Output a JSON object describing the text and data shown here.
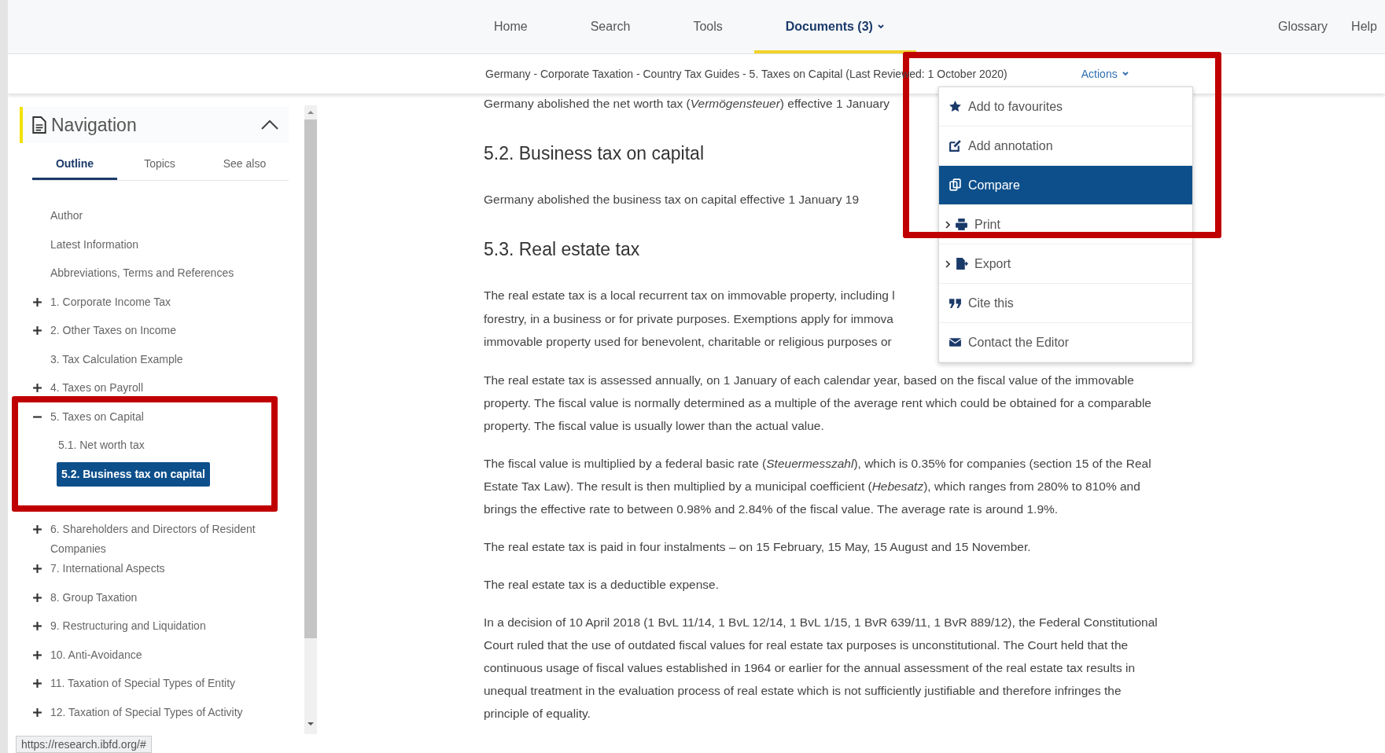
{
  "top_nav": {
    "items": [
      {
        "label": "Home",
        "selected": false,
        "caret": false
      },
      {
        "label": "Search",
        "selected": false,
        "caret": false
      },
      {
        "label": "Tools",
        "selected": false,
        "caret": false
      },
      {
        "label": "Documents (3)",
        "selected": true,
        "caret": true
      }
    ],
    "right_links": [
      "Glossary",
      "Help"
    ]
  },
  "breadcrumb": {
    "text": "Germany - Corporate Taxation - Country Tax Guides - 5. Taxes on Capital (Last Reviewed: 1 October 2020)",
    "actions": "Actions"
  },
  "sidebar": {
    "title": "Navigation",
    "expanded": true,
    "tabs": [
      {
        "label": "Outline",
        "selected": true
      },
      {
        "label": "Topics",
        "selected": false
      },
      {
        "label": "See also",
        "selected": false
      }
    ],
    "items": [
      {
        "label": "Author",
        "selected": false
      },
      {
        "label": "Latest Information",
        "selected": false
      },
      {
        "label": "Abbreviations, Terms and References",
        "selected": false
      },
      {
        "label": "1. Corporate Income Tax",
        "selected": false,
        "expanded": false
      },
      {
        "label": "2. Other Taxes on Income",
        "selected": false,
        "expanded": false
      },
      {
        "label": "3. Tax Calculation Example",
        "selected": false
      },
      {
        "label": "4. Taxes on Payroll",
        "selected": false,
        "expanded": false
      },
      {
        "label": "5. Taxes on Capital",
        "selected": false,
        "expanded": true,
        "children": [
          {
            "label": "5.1. Net worth tax",
            "selected": false
          },
          {
            "label": "5.2. Business tax on capital",
            "selected": true
          }
        ]
      },
      {
        "label": "6. Shareholders and Directors of Resident Companies",
        "selected": false,
        "expanded": false
      },
      {
        "label": "7. International Aspects",
        "selected": false,
        "expanded": false
      },
      {
        "label": "8. Group Taxation",
        "selected": false,
        "expanded": false
      },
      {
        "label": "9. Restructuring and Liquidation",
        "selected": false,
        "expanded": false
      },
      {
        "label": "10. Anti-Avoidance",
        "selected": false,
        "expanded": false
      },
      {
        "label": "11. Taxation of Special Types of Entity",
        "selected": false,
        "expanded": false
      },
      {
        "label": "12. Taxation of Special Types of Activity",
        "selected": false,
        "expanded": false
      }
    ]
  },
  "content": {
    "blocks": [
      {
        "kind": "paragraph",
        "text": "Germany abolished the net worth tax (*Vermögensteuer*) effective 1 January"
      },
      {
        "kind": "heading",
        "text": "5.2. Business tax on capital"
      },
      {
        "kind": "paragraph",
        "text": "Germany abolished the business tax on capital effective 1 January 19"
      },
      {
        "kind": "heading",
        "text": "5.3. Real estate tax"
      },
      {
        "kind": "lines",
        "lines": [
          "The real estate tax is a local recurrent tax on immovable property, including l",
          "forestry, in a business or for private purposes. Exemptions apply for immova",
          "immovable property used for benevolent, charitable or religious purposes or"
        ]
      },
      {
        "kind": "paragraph",
        "text": "The real estate tax is assessed annually, on 1 January of each calendar year, based on the fiscal value of the immovable property. The fiscal value is normally determined as a multiple of the average rent which could be obtained for a comparable property. The fiscal value is usually lower than the actual value."
      },
      {
        "kind": "paragraph",
        "text": "The fiscal value is multiplied by a federal basic rate (*Steuermesszahl*), which is 0.35% for companies (section 15 of the Real Estate Tax Law). The result is then multiplied by a municipal coefficient (*Hebesatz*), which ranges from 280% to 810% and brings the effective rate to between 0.98% and 2.84% of the fiscal value. The average rate is around 1.9%."
      },
      {
        "kind": "paragraph",
        "text": "The real estate tax is paid in four instalments – on 15 February, 15 May, 15 August and 15 November."
      },
      {
        "kind": "paragraph",
        "text": "The real estate tax is a deductible expense."
      },
      {
        "kind": "paragraph",
        "text": "In a decision of 10 April 2018 (1 BvL 11/14, 1 BvL 12/14, 1 BvL 1/15, 1 BvR 639/11, 1 BvR 889/12), the Federal Constitutional Court ruled that the use of outdated fiscal values for real estate tax purposes is unconstitutional. The Court held that the continuous usage of fiscal values established in 1964 or earlier for the annual assessment of the real estate tax results in unequal treatment in the evaluation process of real estate which is not sufficiently justifiable and therefore infringes the principle of equality."
      }
    ]
  },
  "actions_menu": {
    "items": [
      {
        "label": "Add to favourites",
        "selected": false,
        "submenu": false
      },
      {
        "label": "Add annotation",
        "selected": false,
        "submenu": false
      },
      {
        "label": "Compare",
        "selected": true,
        "submenu": false
      },
      {
        "label": "Print",
        "selected": false,
        "submenu": true
      },
      {
        "label": "Export",
        "selected": false,
        "submenu": true
      },
      {
        "label": "Cite this",
        "selected": false,
        "submenu": false
      },
      {
        "label": "Contact the Editor",
        "selected": false,
        "submenu": false
      }
    ]
  },
  "status_url": "https://research.ibfd.org/#"
}
